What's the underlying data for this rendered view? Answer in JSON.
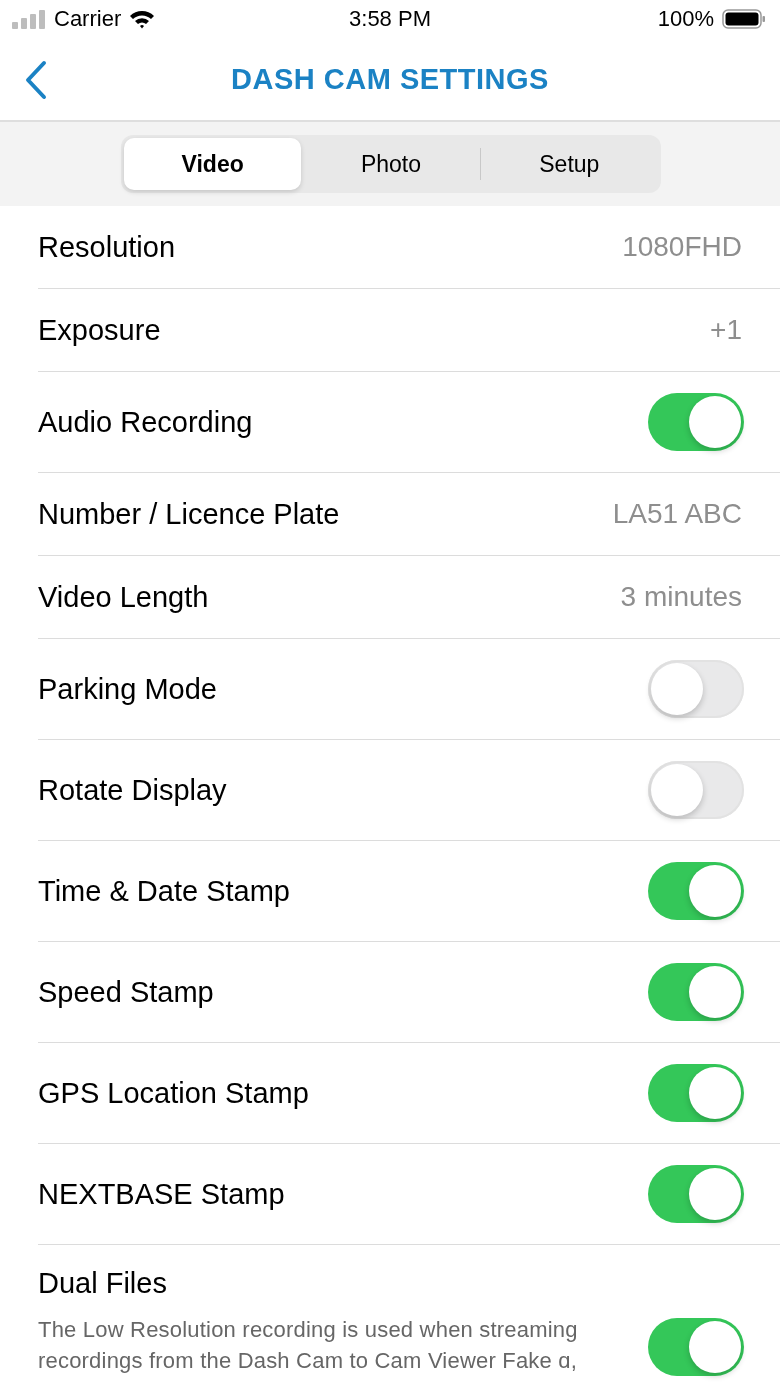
{
  "status_bar": {
    "carrier": "Carrier",
    "time": "3:58 PM",
    "battery": "100%"
  },
  "nav": {
    "title": "DASH CAM SETTINGS"
  },
  "tabs": [
    {
      "label": "Video",
      "selected": true
    },
    {
      "label": "Photo",
      "selected": false
    },
    {
      "label": "Setup",
      "selected": false
    }
  ],
  "settings": [
    {
      "kind": "value",
      "label": "Resolution",
      "value": "1080FHD"
    },
    {
      "kind": "value",
      "label": "Exposure",
      "value": "+1"
    },
    {
      "kind": "toggle",
      "label": "Audio Recording",
      "on": true
    },
    {
      "kind": "value",
      "label": "Number / Licence Plate",
      "value": "LA51 ABC"
    },
    {
      "kind": "value",
      "label": "Video Length",
      "value": "3 minutes"
    },
    {
      "kind": "toggle",
      "label": "Parking Mode",
      "on": false
    },
    {
      "kind": "toggle",
      "label": "Rotate Display",
      "on": false
    },
    {
      "kind": "toggle",
      "label": "Time & Date Stamp",
      "on": true
    },
    {
      "kind": "toggle",
      "label": "Speed Stamp",
      "on": true
    },
    {
      "kind": "toggle",
      "label": "GPS Location Stamp",
      "on": true
    },
    {
      "kind": "toggle",
      "label": "NEXTBASE Stamp",
      "on": true
    },
    {
      "kind": "toggle",
      "label": "Dual Files",
      "on": true,
      "description": "The Low Resolution recording is used when streaming recordings from the Dash Cam to Cam Viewer Fake ɑ,"
    }
  ]
}
